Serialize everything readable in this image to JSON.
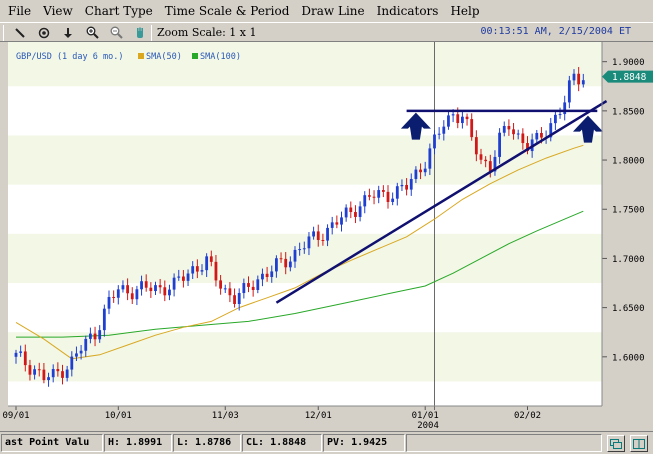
{
  "menu": [
    "File",
    "View",
    "Chart Type",
    "Time Scale & Period",
    "Draw Line",
    "Indicators",
    "Help"
  ],
  "toolbar": {
    "zoom_label": "Zoom Scale: 1 x 1",
    "clock": "00:13:51 AM, 2/15/2004 ET",
    "tools": [
      "draw-line-icon",
      "target-icon",
      "down-arrow-icon",
      "zoom-in-icon",
      "zoom-out-icon",
      "hand-icon"
    ]
  },
  "legend": {
    "symbol": "GBP/USD (1 day  6 mo.)",
    "sma50": "SMA(50)",
    "sma100": "SMA(100)"
  },
  "colors": {
    "up": "#1f3fd0",
    "down": "#d01818",
    "sma50": "#d9a820",
    "sma100": "#28a828",
    "trend": "#101070",
    "marker": "#0b1d6e",
    "price_tag": "#1a8a7a"
  },
  "last_price": "1.8848",
  "status": {
    "last_point": "ast Point Valu",
    "high": "H: 1.8991",
    "low": "L: 1.8786",
    "close": "CL: 1.8848",
    "pv": "PV: 1.9425"
  },
  "chart_data": {
    "type": "candlestick",
    "title": "GBP/USD (1 day  6 mo.)",
    "x_ticks": [
      [
        "09/01",
        0
      ],
      [
        "10/01",
        22
      ],
      [
        "11/03",
        45
      ],
      [
        "12/01",
        65
      ],
      [
        "01/01",
        88
      ],
      [
        "02/02",
        110
      ]
    ],
    "year_label": "2004",
    "ylim": [
      1.55,
      1.92
    ],
    "y_ticks": [
      "1.9000",
      "1.8500",
      "1.8000",
      "1.7500",
      "1.7000",
      "1.6500",
      "1.6000"
    ],
    "anchors": [
      [
        0,
        1.6
      ],
      [
        4,
        1.588
      ],
      [
        6,
        1.578
      ],
      [
        8,
        1.58
      ],
      [
        10,
        1.588
      ],
      [
        12,
        1.595
      ],
      [
        14,
        1.608
      ],
      [
        17,
        1.625
      ],
      [
        20,
        1.655
      ],
      [
        22,
        1.668
      ],
      [
        26,
        1.668
      ],
      [
        30,
        1.67
      ],
      [
        34,
        1.672
      ],
      [
        38,
        1.69
      ],
      [
        41,
        1.696
      ],
      [
        43,
        1.68
      ],
      [
        45,
        1.668
      ],
      [
        47,
        1.66
      ],
      [
        49,
        1.665
      ],
      [
        52,
        1.68
      ],
      [
        55,
        1.688
      ],
      [
        58,
        1.698
      ],
      [
        61,
        1.71
      ],
      [
        64,
        1.72
      ],
      [
        67,
        1.73
      ],
      [
        70,
        1.74
      ],
      [
        73,
        1.752
      ],
      [
        76,
        1.762
      ],
      [
        79,
        1.765
      ],
      [
        82,
        1.768
      ],
      [
        84,
        1.772
      ],
      [
        86,
        1.786
      ],
      [
        88,
        1.8
      ],
      [
        90,
        1.818
      ],
      [
        92,
        1.836
      ],
      [
        94,
        1.848
      ],
      [
        96,
        1.845
      ],
      [
        98,
        1.82
      ],
      [
        100,
        1.8
      ],
      [
        102,
        1.795
      ],
      [
        104,
        1.82
      ],
      [
        106,
        1.835
      ],
      [
        108,
        1.825
      ],
      [
        110,
        1.815
      ],
      [
        112,
        1.818
      ],
      [
        114,
        1.83
      ],
      [
        116,
        1.845
      ],
      [
        118,
        1.858
      ],
      [
        120,
        1.885
      ],
      [
        122,
        1.8848
      ]
    ],
    "sma50": [
      [
        0,
        1.635
      ],
      [
        6,
        1.618
      ],
      [
        12,
        1.598
      ],
      [
        18,
        1.602
      ],
      [
        24,
        1.612
      ],
      [
        30,
        1.622
      ],
      [
        36,
        1.63
      ],
      [
        42,
        1.636
      ],
      [
        48,
        1.65
      ],
      [
        54,
        1.66
      ],
      [
        60,
        1.67
      ],
      [
        66,
        1.685
      ],
      [
        72,
        1.698
      ],
      [
        78,
        1.71
      ],
      [
        84,
        1.722
      ],
      [
        90,
        1.74
      ],
      [
        96,
        1.76
      ],
      [
        102,
        1.776
      ],
      [
        108,
        1.79
      ],
      [
        114,
        1.802
      ],
      [
        120,
        1.812
      ],
      [
        122,
        1.815
      ]
    ],
    "sma100": [
      [
        0,
        1.62
      ],
      [
        10,
        1.62
      ],
      [
        20,
        1.622
      ],
      [
        30,
        1.628
      ],
      [
        40,
        1.632
      ],
      [
        50,
        1.636
      ],
      [
        60,
        1.644
      ],
      [
        70,
        1.654
      ],
      [
        80,
        1.664
      ],
      [
        88,
        1.672
      ],
      [
        94,
        1.685
      ],
      [
        100,
        1.7
      ],
      [
        106,
        1.715
      ],
      [
        112,
        1.728
      ],
      [
        118,
        1.74
      ],
      [
        122,
        1.748
      ]
    ],
    "support_line": [
      [
        56,
        1.655
      ],
      [
        127,
        1.86
      ]
    ],
    "resistance_line": [
      [
        84,
        1.85
      ],
      [
        122,
        1.85
      ]
    ],
    "up_markers": [
      [
        86,
        1.835
      ],
      [
        123,
        1.832
      ]
    ],
    "vline_x": 90
  }
}
